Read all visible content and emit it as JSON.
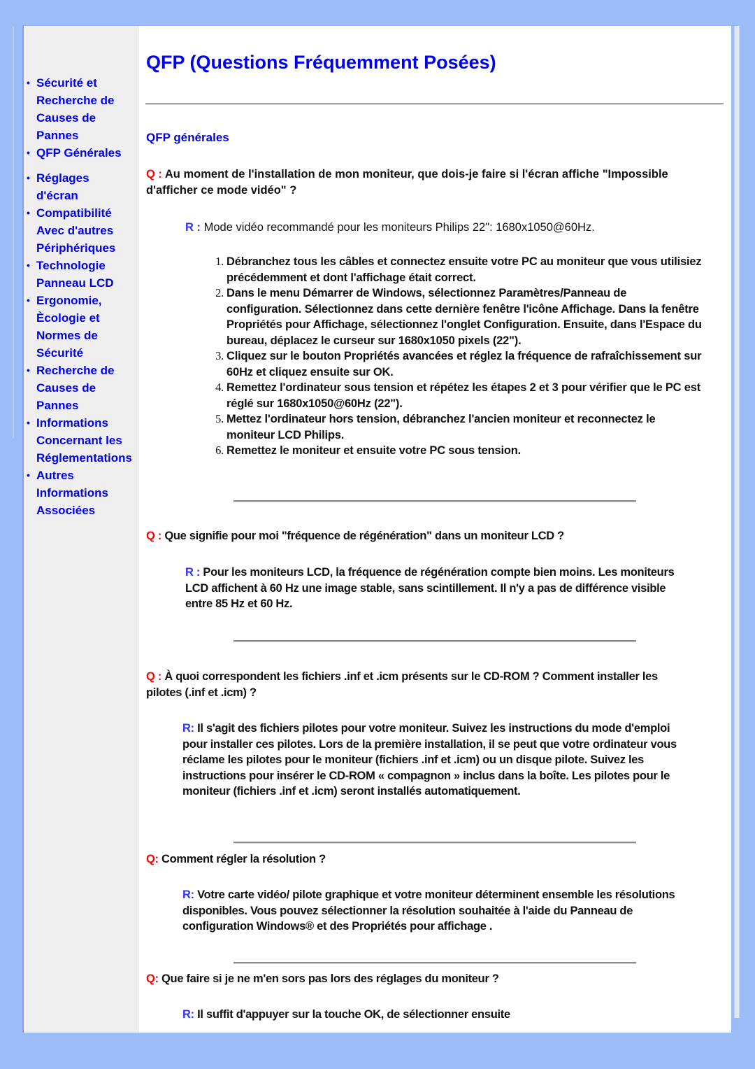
{
  "sidebar": {
    "items": [
      {
        "lines": [
          "Sécurité et",
          "Recherche de",
          "Causes de",
          "Pannes"
        ]
      },
      {
        "lines": [
          "QFP Générales"
        ]
      },
      {
        "lines": [
          "Réglages",
          "d'écran"
        ]
      },
      {
        "lines": [
          "Compatibilité",
          "Avec d'autres",
          "Périphériques"
        ]
      },
      {
        "lines": [
          "Technologie",
          "Panneau LCD"
        ]
      },
      {
        "lines": [
          "Ergonomie,",
          "Ècologie et",
          "Normes de",
          "Sécurité"
        ]
      },
      {
        "lines": [
          "Recherche de",
          "Causes de",
          "Pannes"
        ]
      },
      {
        "lines": [
          "Informations",
          "Concernant les",
          "Réglementations"
        ]
      },
      {
        "lines": [
          "Autres",
          "Informations",
          "Associées"
        ]
      }
    ]
  },
  "page": {
    "title": "QFP (Questions Fréquemment Posées)",
    "section_title": "QFP générales"
  },
  "faq": [
    {
      "q_label": "Q : ",
      "question": "Au moment de l'installation de mon moniteur, que dois-je faire si l'écran affiche \"Impossible d'afficher ce mode vidéo\" ?",
      "r_label": "R : ",
      "answer": "Mode vidéo recommandé pour les moniteurs Philips 22\": 1680x1050@60Hz.",
      "steps": [
        "Débranchez tous les câbles et connectez ensuite votre PC au moniteur que vous utilisiez précédemment et dont l'affichage était correct.",
        "Dans le menu Démarrer de Windows, sélectionnez Paramètres/Panneau de configuration. Sélectionnez dans cette dernière fenêtre l'icône Affichage. Dans la fenêtre Propriétés pour Affichage, sélectionnez l'onglet Configuration. Ensuite, dans l'Espace du bureau, déplacez le curseur sur 1680x1050 pixels (22\").",
        "Cliquez sur le bouton Propriétés avancées et réglez la fréquence de rafraîchissement sur 60Hz et cliquez ensuite sur OK.",
        "Remettez l'ordinateur sous tension et répétez les étapes 2 et 3 pour vérifier que le PC est réglé sur 1680x1050@60Hz (22\").",
        "Mettez l'ordinateur hors tension, débranchez l'ancien moniteur et reconnectez le moniteur LCD Philips.",
        "Remettez le moniteur et ensuite votre PC sous tension."
      ]
    },
    {
      "q_label": "Q : ",
      "question": "Que signifie pour moi \"fréquence de régénération\" dans un moniteur LCD ?",
      "r_label": "R : ",
      "answer": "Pour les moniteurs LCD, la fréquence de régénération compte bien moins. Les moniteurs LCD affichent à 60 Hz une image stable, sans scintillement. Il n'y a pas de différence visible entre 85 Hz et 60 Hz."
    },
    {
      "q_label": "Q : ",
      "question": "À quoi correspondent les fichiers .inf et .icm présents sur le CD-ROM ? Comment installer les pilotes (.inf et .icm) ?",
      "r_label": "R: ",
      "answer": "Il s'agit des fichiers pilotes pour votre moniteur. Suivez les instructions du mode d'emploi pour installer ces pilotes. Lors de la première installation, il se peut que votre ordinateur vous réclame les pilotes pour   le moniteur (fichiers .inf et .icm) ou un disque pilote. Suivez les instructions pour insérer le CD-ROM « compagnon » inclus dans la boîte. Les pilotes pour le moniteur (fichiers .inf et .icm) seront installés automatiquement."
    },
    {
      "q_label": "Q: ",
      "question": "Comment régler la résolution ?",
      "r_label": "R: ",
      "answer": "Votre carte vidéo/ pilote graphique et votre moniteur déterminent ensemble les résolutions disponibles. Vous pouvez sélectionner la résolution souhaitée à l'aide du Panneau de configuration Windows® et des Propriétés pour affichage ."
    },
    {
      "q_label": "Q: ",
      "question": "Que faire si je ne m'en sors pas lors des réglages du moniteur ?",
      "r_label": "R: ",
      "answer": "Il suffit d'appuyer sur la touche OK, de sélectionner ensuite"
    }
  ],
  "colors": {
    "background": "#9bbcf7",
    "link": "#0000ee",
    "q_label": "#ff0000",
    "r_label": "#3333ff"
  }
}
